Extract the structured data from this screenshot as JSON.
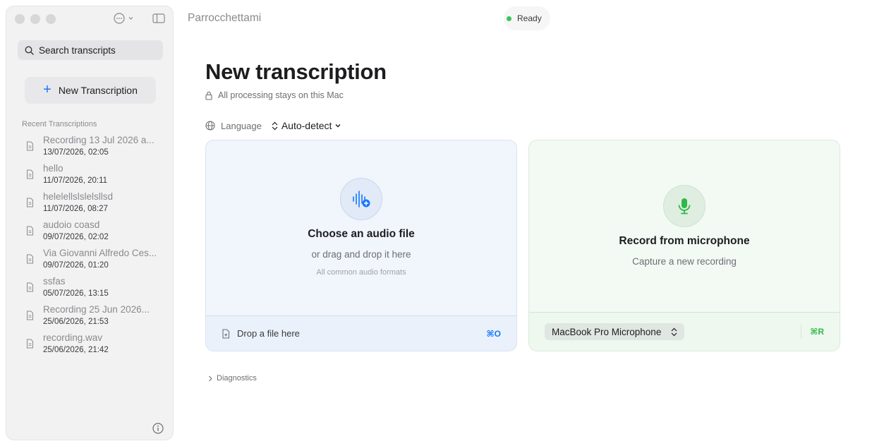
{
  "window": {
    "title": "Parrocchettami"
  },
  "status": {
    "label": "Ready",
    "color": "#34c759"
  },
  "sidebar": {
    "search_placeholder": "Search transcripts",
    "new_button": "New Transcription",
    "recent_heading": "Recent Transcriptions",
    "items": [
      {
        "title": "Recording 13 Jul 2026 a...",
        "date": "13/07/2026, 02:05"
      },
      {
        "title": "hello",
        "date": "11/07/2026, 20:11"
      },
      {
        "title": "helelellslslelsllsd",
        "date": "11/07/2026, 08:27"
      },
      {
        "title": "audoio coasd",
        "date": "09/07/2026, 02:02"
      },
      {
        "title": "Via Giovanni Alfredo Ces...",
        "date": "09/07/2026, 01:20"
      },
      {
        "title": "ssfas",
        "date": "05/07/2026, 13:15"
      },
      {
        "title": "Recording 25 Jun 2026...",
        "date": "25/06/2026, 21:53"
      },
      {
        "title": "recording.wav",
        "date": "25/06/2026, 21:42"
      }
    ]
  },
  "main": {
    "title": "New transcription",
    "subtitle": "All processing stays on this Mac",
    "language_label": "Language",
    "language_value": "Auto-detect",
    "file_card": {
      "title": "Choose an audio file",
      "subtitle": "or drag and drop it here",
      "note": "All common audio formats",
      "footer": "Drop a file here",
      "shortcut": "⌘O",
      "accent": "#1677ff"
    },
    "mic_card": {
      "title": "Record from microphone",
      "subtitle": "Capture a new recording",
      "device": "MacBook Pro Microphone",
      "shortcut": "⌘R",
      "accent": "#2fb84a"
    },
    "diagnostics": "Diagnostics"
  },
  "icons": [
    "search-icon",
    "plus-icon",
    "document-icon",
    "info-icon",
    "lock-icon",
    "globe-icon",
    "waveform-add-icon",
    "microphone-icon",
    "updown-chevron-icon",
    "chevron-right-icon"
  ]
}
